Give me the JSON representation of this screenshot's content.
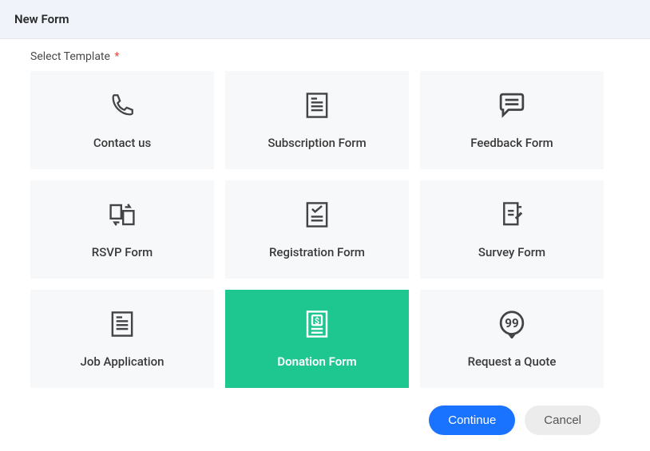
{
  "header": {
    "title": "New Form"
  },
  "field": {
    "label": "Select Template",
    "required_mark": "*"
  },
  "templates": [
    {
      "id": "contact-us",
      "label": "Contact us",
      "icon": "phone-icon",
      "selected": false
    },
    {
      "id": "subscription-form",
      "label": "Subscription Form",
      "icon": "document-lines-icon",
      "selected": false
    },
    {
      "id": "feedback-form",
      "label": "Feedback Form",
      "icon": "chat-icon",
      "selected": false
    },
    {
      "id": "rsvp-form",
      "label": "RSVP Form",
      "icon": "rsvp-icon",
      "selected": false
    },
    {
      "id": "registration-form",
      "label": "Registration Form",
      "icon": "checklist-icon",
      "selected": false
    },
    {
      "id": "survey-form",
      "label": "Survey Form",
      "icon": "survey-icon",
      "selected": false
    },
    {
      "id": "job-application",
      "label": "Job Application",
      "icon": "document-lines-icon",
      "selected": false
    },
    {
      "id": "donation-form",
      "label": "Donation Form",
      "icon": "donation-icon",
      "selected": true
    },
    {
      "id": "request-a-quote",
      "label": "Request a Quote",
      "icon": "quote-icon",
      "selected": false
    }
  ],
  "buttons": {
    "continue": "Continue",
    "cancel": "Cancel"
  },
  "colors": {
    "accent_selected": "#1fc790",
    "primary_button": "#1a73ff",
    "card_bg": "#f7f8fa",
    "header_bg": "#f0f3f9"
  }
}
